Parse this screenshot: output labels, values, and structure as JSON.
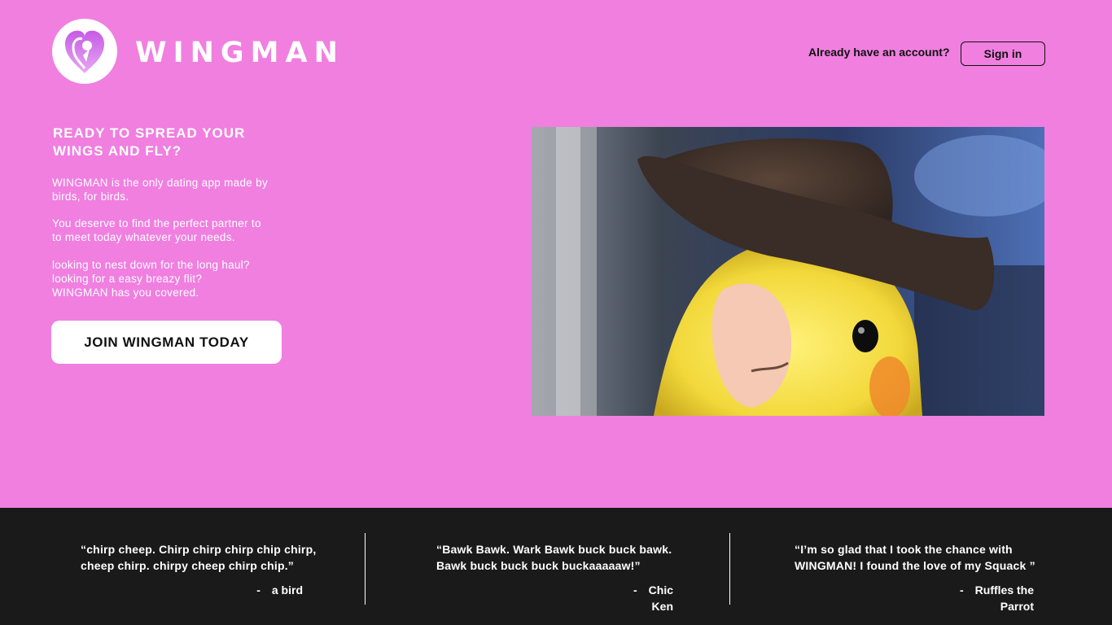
{
  "brand": {
    "name": "WINGMAN",
    "logo_icon": "heart-bird-icon",
    "accent_color": "#f07fe0",
    "logo_color": "#b64fd9"
  },
  "header": {
    "account_question": "Already have an account?",
    "signin_label": "Sign in"
  },
  "hero": {
    "headline": "READY TO SPREAD YOUR WINGS AND FLY?",
    "paragraphs": [
      "WINGMAN is the only dating app made by\nbirds, for birds.",
      "You deserve to find the perfect partner to\nto meet today whatever your needs.",
      "looking to nest down for the long haul?\nlooking for a easy breazy flit?\nWINGMAN has you covered."
    ],
    "cta_label": "JOIN WINGMAN TODAY",
    "image_subject": "cockatiel-in-cowboy-hat"
  },
  "testimonials": [
    {
      "quote": "“chirp cheep. Chirp chirp chirp chip chirp,\ncheep chirp. chirpy cheep chirp chip.”",
      "dash": "-",
      "author": "a bird"
    },
    {
      "quote": "“Bawk Bawk. Wark Bawk buck buck bawk.\nBawk buck buck buck buckaaaaaw!”",
      "dash": "-",
      "author": "Chic Ken"
    },
    {
      "quote": "“I’m so glad that I took the chance with\nWINGMAN! I found the love of my Squack ”",
      "dash": "-",
      "author": "Ruffles the Parrot"
    }
  ]
}
